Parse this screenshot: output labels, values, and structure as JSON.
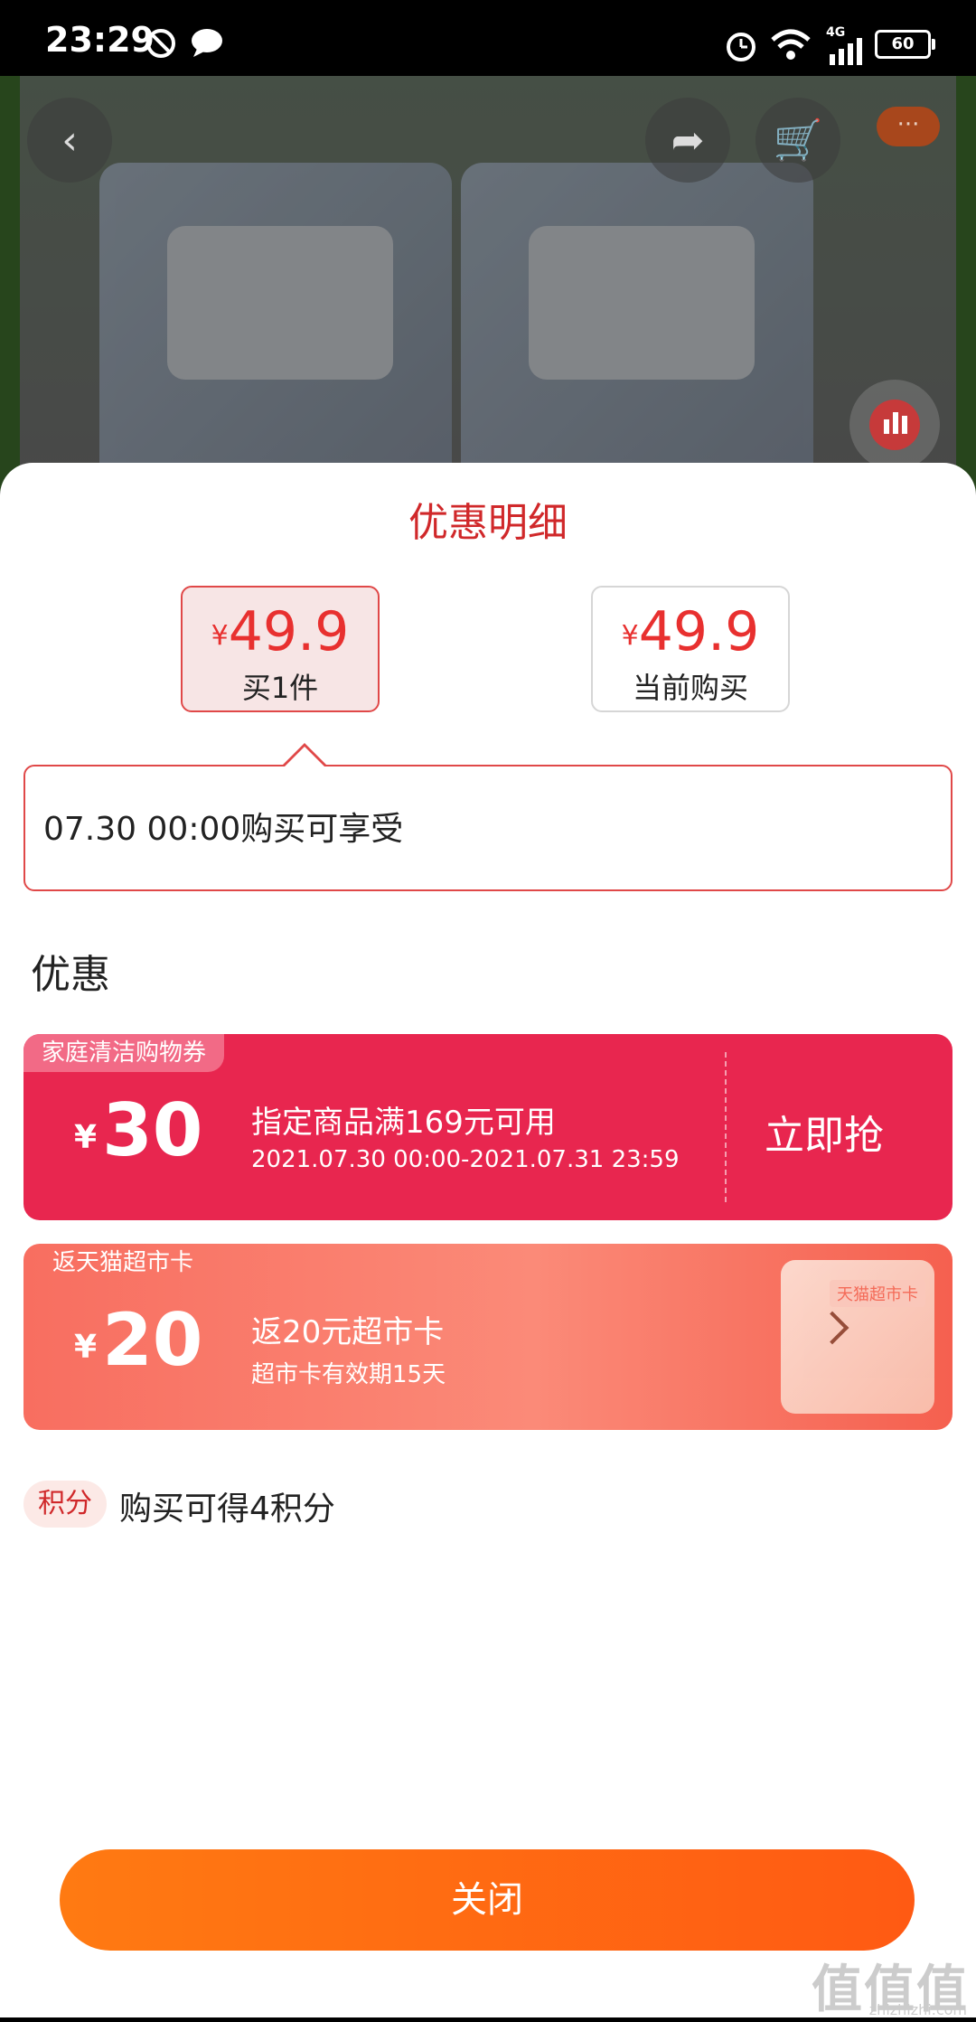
{
  "status_bar": {
    "time": "23:29",
    "network": "4G",
    "battery": "60"
  },
  "background": {
    "nav_icons": [
      "back-icon",
      "share-icon",
      "cart-icon",
      "more-icon",
      "chart-icon"
    ],
    "more_label": "···"
  },
  "sheet": {
    "title": "优惠明细",
    "price_options": [
      {
        "currency": "¥",
        "price": "49.9",
        "label": "买1件",
        "selected": true
      },
      {
        "currency": "¥",
        "price": "49.9",
        "label": "当前购买",
        "selected": false
      }
    ],
    "info_text": "07.30 00:00购买可享受",
    "section_heading": "优惠",
    "coupons": [
      {
        "tag": "家庭清洁购物券",
        "currency": "¥",
        "amount": "30",
        "main": "指定商品满169元可用",
        "sub": "2021.07.30 00:00-2021.07.31 23:59",
        "cta": "立即抢"
      },
      {
        "tag": "返天猫超市卡",
        "currency": "¥",
        "amount": "20",
        "main": "返20元超市卡",
        "sub": "超市卡有效期15天",
        "card_label": "天猫超市卡"
      }
    ],
    "points": {
      "badge": "积分",
      "text": "购买可得4积分"
    },
    "close_label": "关闭"
  },
  "watermark": {
    "text": "值值值",
    "sub": "zhizhizhi.com"
  },
  "colors": {
    "accent": "#d0282a",
    "coupon_red": "#e8264f",
    "button_orange": "#ff6a12"
  }
}
